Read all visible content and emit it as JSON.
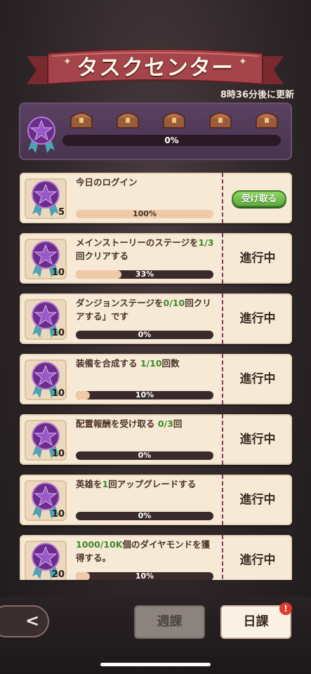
{
  "header": {
    "title": "タスクセンター",
    "refresh_text": "8時36分後に更新"
  },
  "overall": {
    "progress_label": "0%",
    "progress": 0,
    "chest_count": 5
  },
  "tasks": [
    {
      "reward": "5",
      "desc_parts": [
        "今日のログイン",
        "",
        ""
      ],
      "progress_label": "100%",
      "progress": 1.0,
      "status": "受け取る",
      "claimable": true
    },
    {
      "reward": "10",
      "desc_parts": [
        "メインストーリーのステージを",
        "1/3",
        "回クリアする"
      ],
      "progress_label": "33%",
      "progress": 0.33,
      "status": "進行中",
      "claimable": false
    },
    {
      "reward": "10",
      "desc_parts": [
        "ダンジョンステージを",
        "0/10",
        "回クリアする」です"
      ],
      "progress_label": "0%",
      "progress": 0,
      "status": "進行中",
      "claimable": false
    },
    {
      "reward": "10",
      "desc_parts": [
        "装備を合成する ",
        "1/10",
        "回数"
      ],
      "progress_label": "10%",
      "progress": 0.1,
      "status": "進行中",
      "claimable": false
    },
    {
      "reward": "10",
      "desc_parts": [
        "配置報酬を受け取る ",
        "0/3",
        "回"
      ],
      "progress_label": "0%",
      "progress": 0,
      "status": "進行中",
      "claimable": false
    },
    {
      "reward": "10",
      "desc_parts": [
        "英雄を",
        "1",
        "回アップグレードする"
      ],
      "progress_label": "0%",
      "progress": 0,
      "status": "進行中",
      "claimable": false
    },
    {
      "reward": "20",
      "desc_parts": [
        "",
        "1000/10K",
        "個のダイヤモンドを獲得する。"
      ],
      "progress_label": "10%",
      "progress": 0.1,
      "status": "進行中",
      "claimable": false
    }
  ],
  "footer": {
    "back_label": "<",
    "weekly_label": "週課",
    "daily_label": "日課",
    "alert": "!"
  },
  "colors": {
    "accent": "#7b3d58",
    "claim": "#5aa83b",
    "highlight": "#3e8a28"
  }
}
